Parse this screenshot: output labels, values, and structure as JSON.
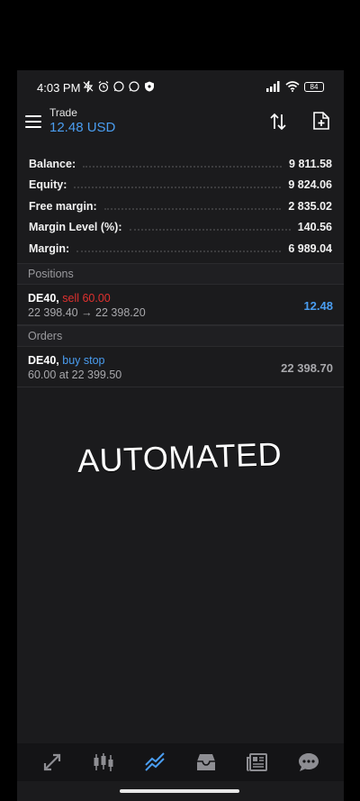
{
  "status_bar": {
    "time": "4:03 PM",
    "battery": "84"
  },
  "header": {
    "title": "Trade",
    "value": "12.48 USD"
  },
  "summary": [
    {
      "label": "Balance:",
      "value": "9 811.58"
    },
    {
      "label": "Equity:",
      "value": "9 824.06"
    },
    {
      "label": "Free margin:",
      "value": "2 835.02"
    },
    {
      "label": "Margin Level (%):",
      "value": "140.56"
    },
    {
      "label": "Margin:",
      "value": "6 989.04"
    }
  ],
  "positions": {
    "header": "Positions",
    "items": [
      {
        "symbol": "DE40",
        "sep": ",",
        "action": "sell 60.00",
        "prices": "22 398.40 → 22 398.20",
        "profit": "12.48"
      }
    ]
  },
  "orders": {
    "header": "Orders",
    "items": [
      {
        "symbol": "DE40",
        "sep": ",",
        "action": "buy stop",
        "detail": "60.00 at 22 399.50",
        "price": "22 398.70"
      }
    ]
  },
  "overlay_text": "AUTOMATED",
  "bottom_nav": [
    {
      "icon": "quotes-icon",
      "active": false
    },
    {
      "icon": "chart-icon",
      "active": false
    },
    {
      "icon": "trade-icon",
      "active": true
    },
    {
      "icon": "history-icon",
      "active": false
    },
    {
      "icon": "news-icon",
      "active": false
    },
    {
      "icon": "messages-icon",
      "active": false
    }
  ],
  "colors": {
    "accent": "#4a9df0",
    "sell": "#e0312f",
    "background": "#1b1b1d"
  }
}
